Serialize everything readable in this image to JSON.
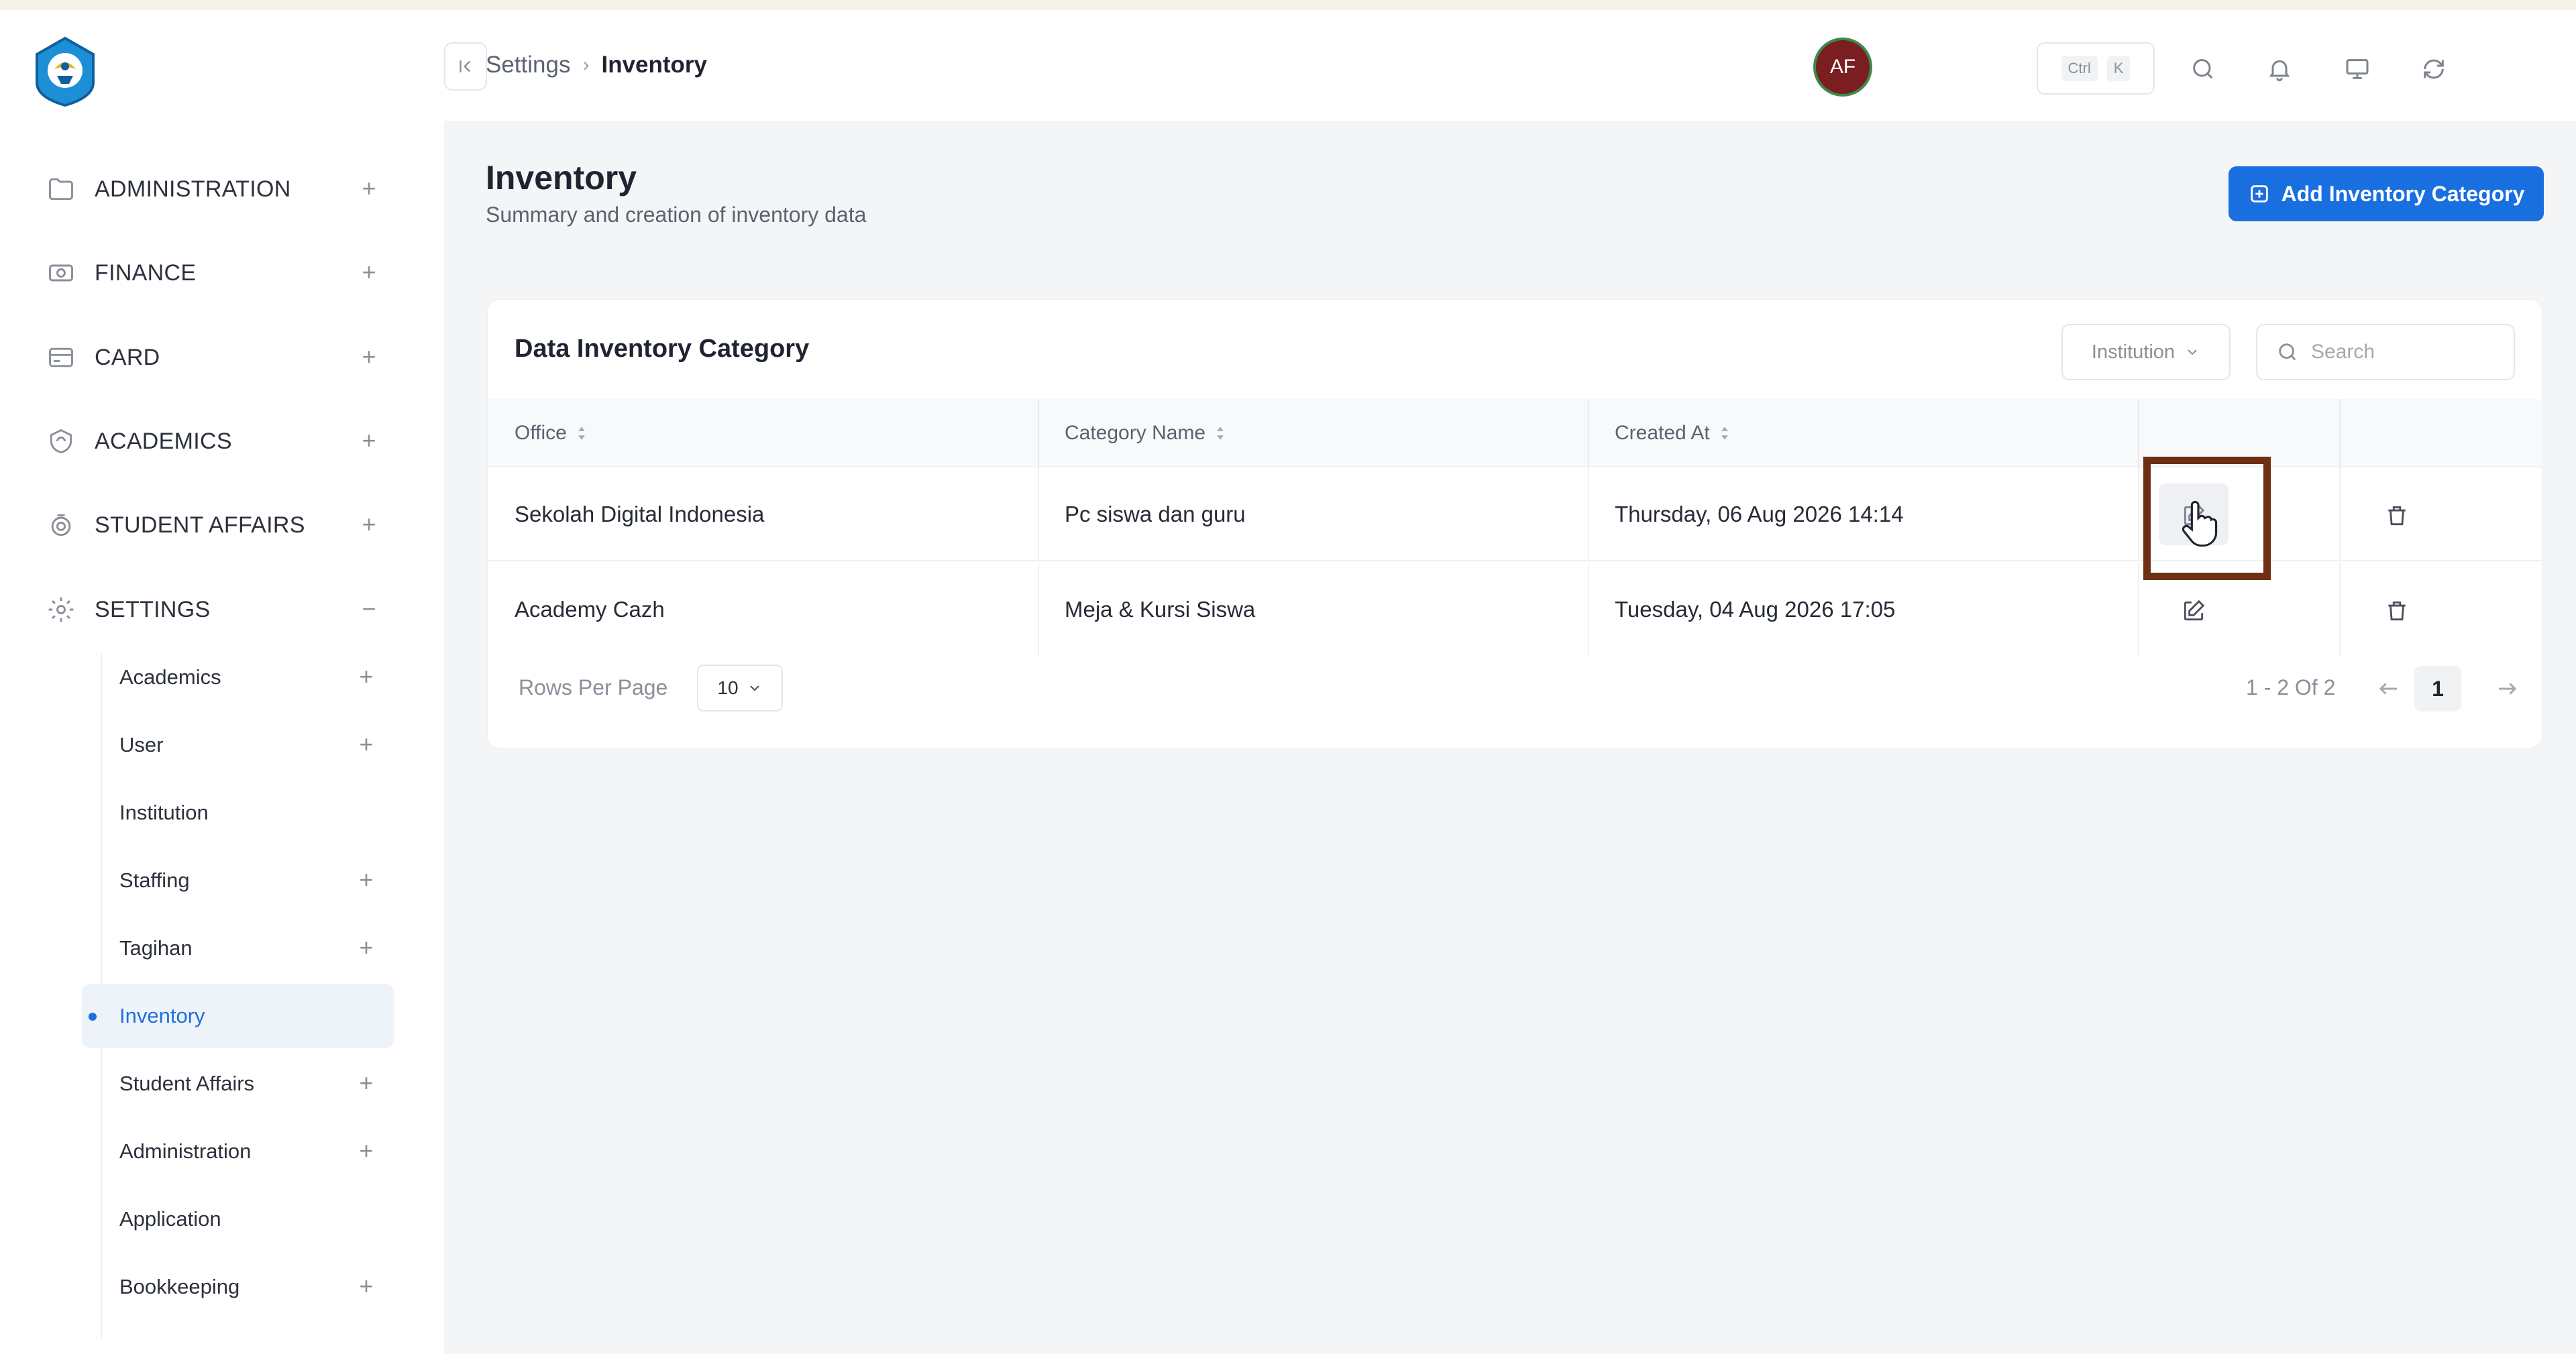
{
  "colors": {
    "accent": "#1a6fe0",
    "highlight_frame": "#6e2f13",
    "avatar_bg": "#7a1e22",
    "avatar_ring": "#3d8a4a",
    "main_bg": "#f4f5f7"
  },
  "sidebar": {
    "sections": [
      {
        "label": "ADMINISTRATION",
        "icon": "folder-icon",
        "toggle": "+"
      },
      {
        "label": "FINANCE",
        "icon": "money-icon",
        "toggle": "+"
      },
      {
        "label": "CARD",
        "icon": "card-icon",
        "toggle": "+"
      },
      {
        "label": "ACADEMICS",
        "icon": "academics-icon",
        "toggle": "+"
      },
      {
        "label": "STUDENT AFFAIRS",
        "icon": "student-affairs-icon",
        "toggle": "+"
      },
      {
        "label": "SETTINGS",
        "icon": "gear-icon",
        "toggle": "−"
      }
    ],
    "settings_items": [
      {
        "label": "Academics",
        "toggle": "+"
      },
      {
        "label": "User",
        "toggle": "+"
      },
      {
        "label": "Institution",
        "toggle": ""
      },
      {
        "label": "Staffing",
        "toggle": "+"
      },
      {
        "label": "Tagihan",
        "toggle": "+"
      },
      {
        "label": "Inventory",
        "toggle": "",
        "active": true
      },
      {
        "label": "Student Affairs",
        "toggle": "+"
      },
      {
        "label": "Administration",
        "toggle": "+"
      },
      {
        "label": "Application",
        "toggle": ""
      },
      {
        "label": "Bookkeeping",
        "toggle": "+"
      }
    ]
  },
  "header": {
    "breadcrumb": [
      "Settings",
      "Inventory"
    ],
    "shortcut_keys": [
      "Ctrl",
      "K"
    ],
    "icons": [
      "search-icon",
      "bell-icon",
      "monitor-icon",
      "refresh-icon"
    ],
    "avatar_initials": "AF"
  },
  "main": {
    "title": "Inventory",
    "subtitle": "Summary and creation of inventory data",
    "add_button_label": "Add Inventory Category"
  },
  "table_card": {
    "title": "Data Inventory Category",
    "filter_label": "Institution",
    "search_placeholder": "Search",
    "columns": [
      "Office",
      "Category Name",
      "Created At"
    ],
    "rows": [
      {
        "office": "Sekolah Digital Indonesia",
        "category": "Pc siswa dan guru",
        "created": "Thursday, 06 Aug 2026 14:14"
      },
      {
        "office": "Academy Cazh",
        "category": "Meja & Kursi Siswa",
        "created": "Tuesday, 04 Aug 2026 17:05"
      }
    ],
    "rows_per_page_label": "Rows Per Page",
    "rows_per_page_value": "10",
    "range_text": "1 - 2 Of 2",
    "current_page": "1"
  }
}
